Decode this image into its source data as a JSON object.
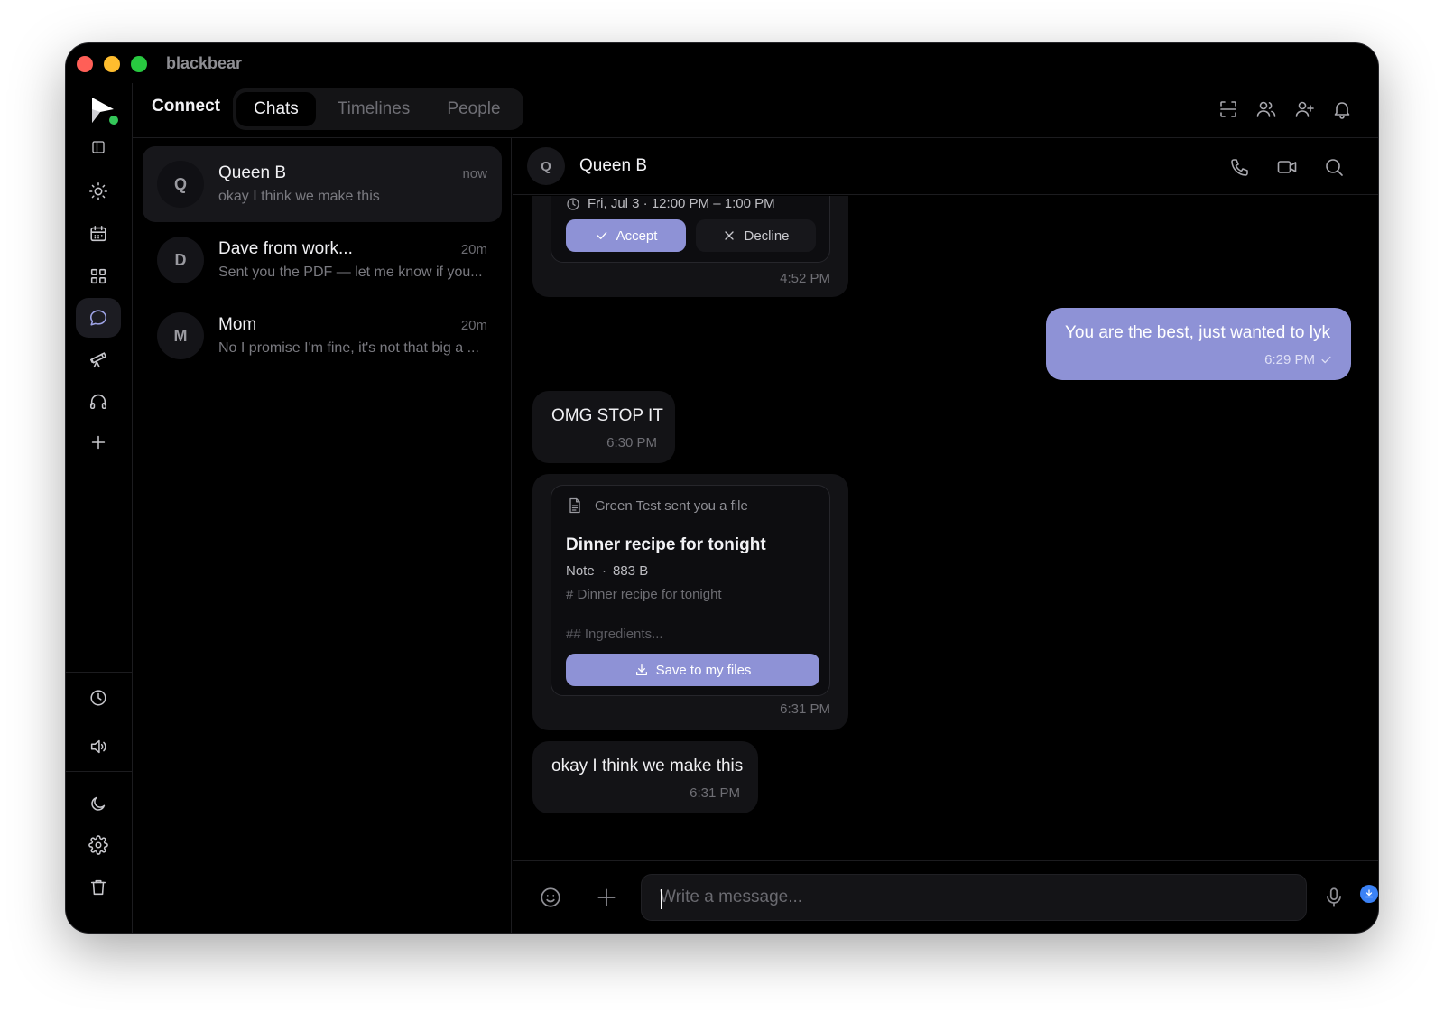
{
  "window": {
    "app_title": "blackbear"
  },
  "header": {
    "section_title": "Connect",
    "tabs": [
      {
        "label": "Chats",
        "active": true
      },
      {
        "label": "Timelines",
        "active": false
      },
      {
        "label": "People",
        "active": false
      }
    ],
    "icons": [
      "scan-icon",
      "group-icon",
      "add-user-icon",
      "bell-icon"
    ]
  },
  "rail": {
    "items": [
      "sidebar-toggle-icon",
      "sun-icon",
      "calendar-icon",
      "grid-icon",
      "chat-bubble-icon",
      "telescope-icon",
      "headphones-icon",
      "plus-icon"
    ],
    "active": "chat-bubble-icon",
    "bottom_items": [
      "clock-icon",
      "speaker-icon",
      "moon-icon",
      "gear-icon",
      "trash-icon"
    ]
  },
  "chats": [
    {
      "initial": "Q",
      "name": "Queen B",
      "time": "now",
      "preview": "okay I think we make this",
      "active": true
    },
    {
      "initial": "D",
      "name": "Dave from work...",
      "time": "20m",
      "preview": "Sent you the PDF — let me know if you...",
      "active": false
    },
    {
      "initial": "M",
      "name": "Mom",
      "time": "20m",
      "preview": "No I promise I'm fine, it's not that big a ...",
      "active": false
    }
  ],
  "conversation": {
    "contact_initial": "Q",
    "contact_name": "Queen B",
    "messages": {
      "event_card": {
        "when": "Fri, Jul 3 · 12:00 PM – 1:00 PM",
        "accept_label": "Accept",
        "decline_label": "Decline",
        "time": "4:52 PM"
      },
      "outgoing_1": {
        "text": "You are the best, just wanted to lyk",
        "time": "6:29 PM"
      },
      "incoming_1": {
        "text": "OMG STOP IT",
        "time": "6:30 PM"
      },
      "file_card": {
        "header": "Green Test sent you a file",
        "title": "Dinner recipe for tonight",
        "type": "Note",
        "size": "883 B",
        "preview_line1": "# Dinner recipe for tonight",
        "preview_line2": "## Ingredients...",
        "save_label": "Save to my files",
        "time": "6:31 PM"
      },
      "incoming_2": {
        "text": "okay I think we make this",
        "time": "6:31 PM"
      }
    }
  },
  "composer": {
    "placeholder": "Write a message...",
    "value": ""
  },
  "colors": {
    "accent": "#8e92d6",
    "background": "#000000"
  }
}
